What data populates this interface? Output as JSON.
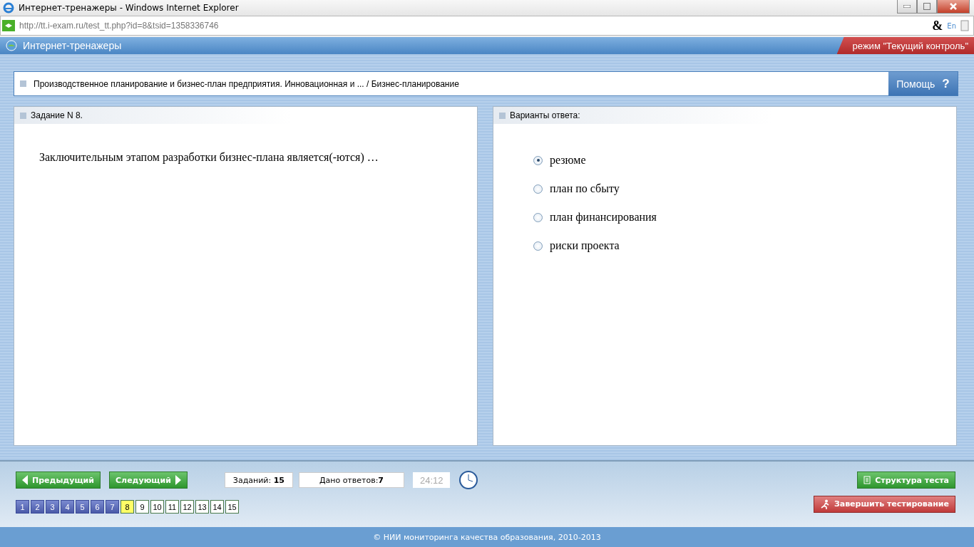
{
  "window": {
    "title": "Интернет-тренажеры - Windows Internet Explorer"
  },
  "address_bar": {
    "url_host": "http://tt.i-exam.ru",
    "url_path": "/test_tt.php?id=8&tsid=1358336746",
    "ampersand": "&",
    "lang": "En"
  },
  "app_header": {
    "title": "Интернет-тренажеры",
    "mode": "режим \"Текущий контроль\""
  },
  "breadcrumb": {
    "text": "Производственное планирование и бизнес-план предприятия. Инновационная и ... / Бизнес-планирование",
    "help": "Помощь",
    "help_mark": "?"
  },
  "question": {
    "heading": "Задание N 8.",
    "text": "Заключительным этапом разработки бизнес-плана является(-ются) …"
  },
  "answers": {
    "heading": "Варианты ответа:",
    "options": [
      {
        "label": "резюме",
        "selected": true
      },
      {
        "label": "план по сбыту",
        "selected": false
      },
      {
        "label": "план финансирования",
        "selected": false
      },
      {
        "label": "риски проекта",
        "selected": false
      }
    ]
  },
  "navigation": {
    "prev": "Предыдущий",
    "next": "Следующий",
    "tasks_label": "Заданий:",
    "tasks_count": "15",
    "answered_label": "Дано ответов:",
    "answered_count": "7",
    "timer": "24:12",
    "structure": "Структура теста",
    "finish": "Завершить тестирование"
  },
  "pages": [
    {
      "label": "1",
      "answered": true,
      "selected": false
    },
    {
      "label": "2",
      "answered": true,
      "selected": false
    },
    {
      "label": "3",
      "answered": true,
      "selected": false
    },
    {
      "label": "4",
      "answered": true,
      "selected": false
    },
    {
      "label": "5",
      "answered": true,
      "selected": false
    },
    {
      "label": "6",
      "answered": true,
      "selected": false
    },
    {
      "label": "7",
      "answered": true,
      "selected": false
    },
    {
      "label": "8",
      "answered": false,
      "selected": true
    },
    {
      "label": "9",
      "answered": false,
      "selected": false
    },
    {
      "label": "10",
      "answered": false,
      "selected": false
    },
    {
      "label": "11",
      "answered": false,
      "selected": false
    },
    {
      "label": "12",
      "answered": false,
      "selected": false
    },
    {
      "label": "13",
      "answered": false,
      "selected": false
    },
    {
      "label": "14",
      "answered": false,
      "selected": false
    },
    {
      "label": "15",
      "answered": false,
      "selected": false
    }
  ],
  "footer": "© НИИ мониторинга качества образования, 2010-2013"
}
